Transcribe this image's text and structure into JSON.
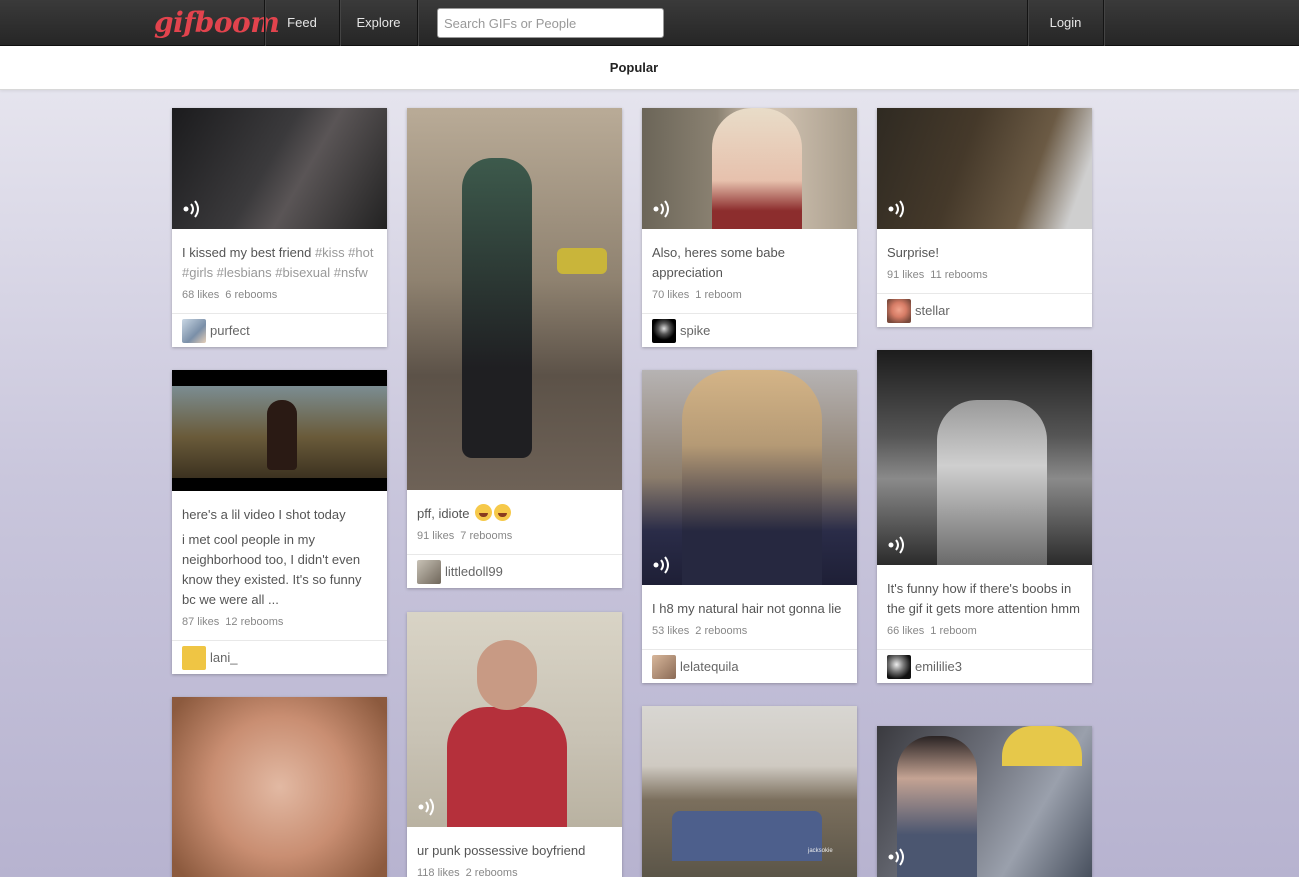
{
  "app": {
    "logo": "gifboom"
  },
  "nav": {
    "feed": "Feed",
    "explore": "Explore",
    "search_placeholder": "Search GIFs or People",
    "login": "Login"
  },
  "subnav": {
    "active_tab": "Popular"
  },
  "colors": {
    "brand": "#e2434d",
    "topbar": "#2e2e2e"
  },
  "posts": [
    {
      "caption": "I kissed my best friend ",
      "tags": "#kiss #hot #girls #lesbians #bisexual #nsfw",
      "likes": "68 likes",
      "reblooms": "6 rebooms",
      "user": "purfect"
    },
    {
      "caption": "here's a lil video I shot today",
      "body": "i met cool people in my neighborhood too, I didn't even know they existed. It's so funny bc we were all ...",
      "likes": "87 likes",
      "reblooms": "12 rebooms",
      "user": "lani_"
    },
    {
      "caption": "pff, idiote",
      "likes": "91 likes",
      "reblooms": "7 rebooms",
      "user": "littledoll99"
    },
    {
      "caption": "ur punk possessive boyfriend",
      "likes": "118 likes",
      "reblooms": "2 rebooms"
    },
    {
      "caption": "Also, heres some babe appreciation",
      "likes": "70 likes",
      "reblooms": "1 reboom",
      "user": "spike"
    },
    {
      "caption": "I h8 my natural hair not gonna lie",
      "likes": "53 likes",
      "reblooms": "2 rebooms",
      "user": "lelatequila"
    },
    {
      "caption": "Surprise!",
      "likes": "91 likes",
      "reblooms": "11 rebooms",
      "user": "stellar"
    },
    {
      "caption": "It's funny how if there's boobs in the gif it gets more attention hmm",
      "likes": "66 likes",
      "reblooms": "1 reboom",
      "user": "emililie3"
    }
  ],
  "overlays": {
    "watermark": "jacksokie"
  },
  "icons": {
    "sound": "sound-icon",
    "emoji": "laughing-emoji-icon"
  }
}
